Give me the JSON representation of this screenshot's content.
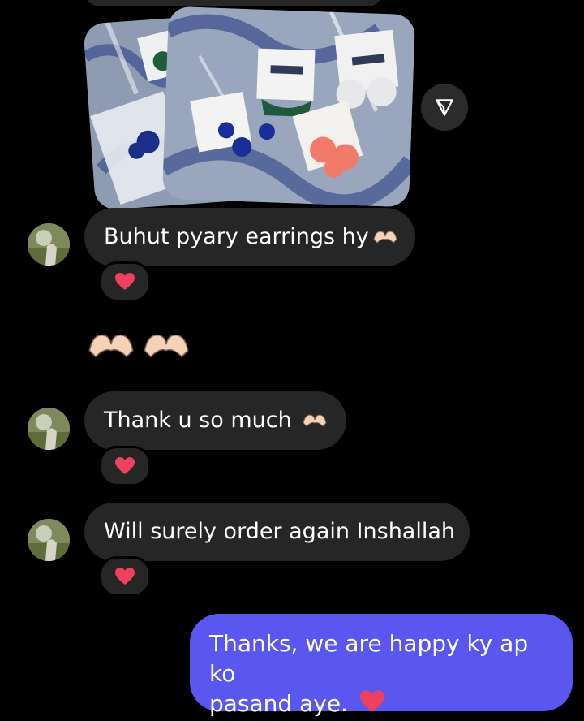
{
  "chat": {
    "share_icon": "send-paper-plane-icon",
    "photos": [
      {
        "description_icon": "earrings-photo-back"
      },
      {
        "description_icon": "earrings-photo-front"
      }
    ],
    "messages": [
      {
        "sender": "received",
        "text": "Buhut pyary earrings hy",
        "trailing_emoji": "heart-hands",
        "reaction": "red-heart"
      },
      {
        "sender": "received",
        "emoji_only": "heart-hands heart-hands"
      },
      {
        "sender": "received",
        "text": "Thank u so much ",
        "trailing_emoji": "heart-hands",
        "reaction": "red-heart"
      },
      {
        "sender": "received",
        "text": "Will surely order again Inshallah",
        "reaction": "red-heart"
      },
      {
        "sender": "sent",
        "text_line1": "Thanks, we are happy ky ap ko",
        "text_line2": "pasand aye.",
        "trailing_emoji": "red-heart"
      }
    ]
  },
  "colors": {
    "background": "#000000",
    "received_bubble": "#262626",
    "sent_bubble": "#5a57f0",
    "heart": "#f0405f"
  }
}
